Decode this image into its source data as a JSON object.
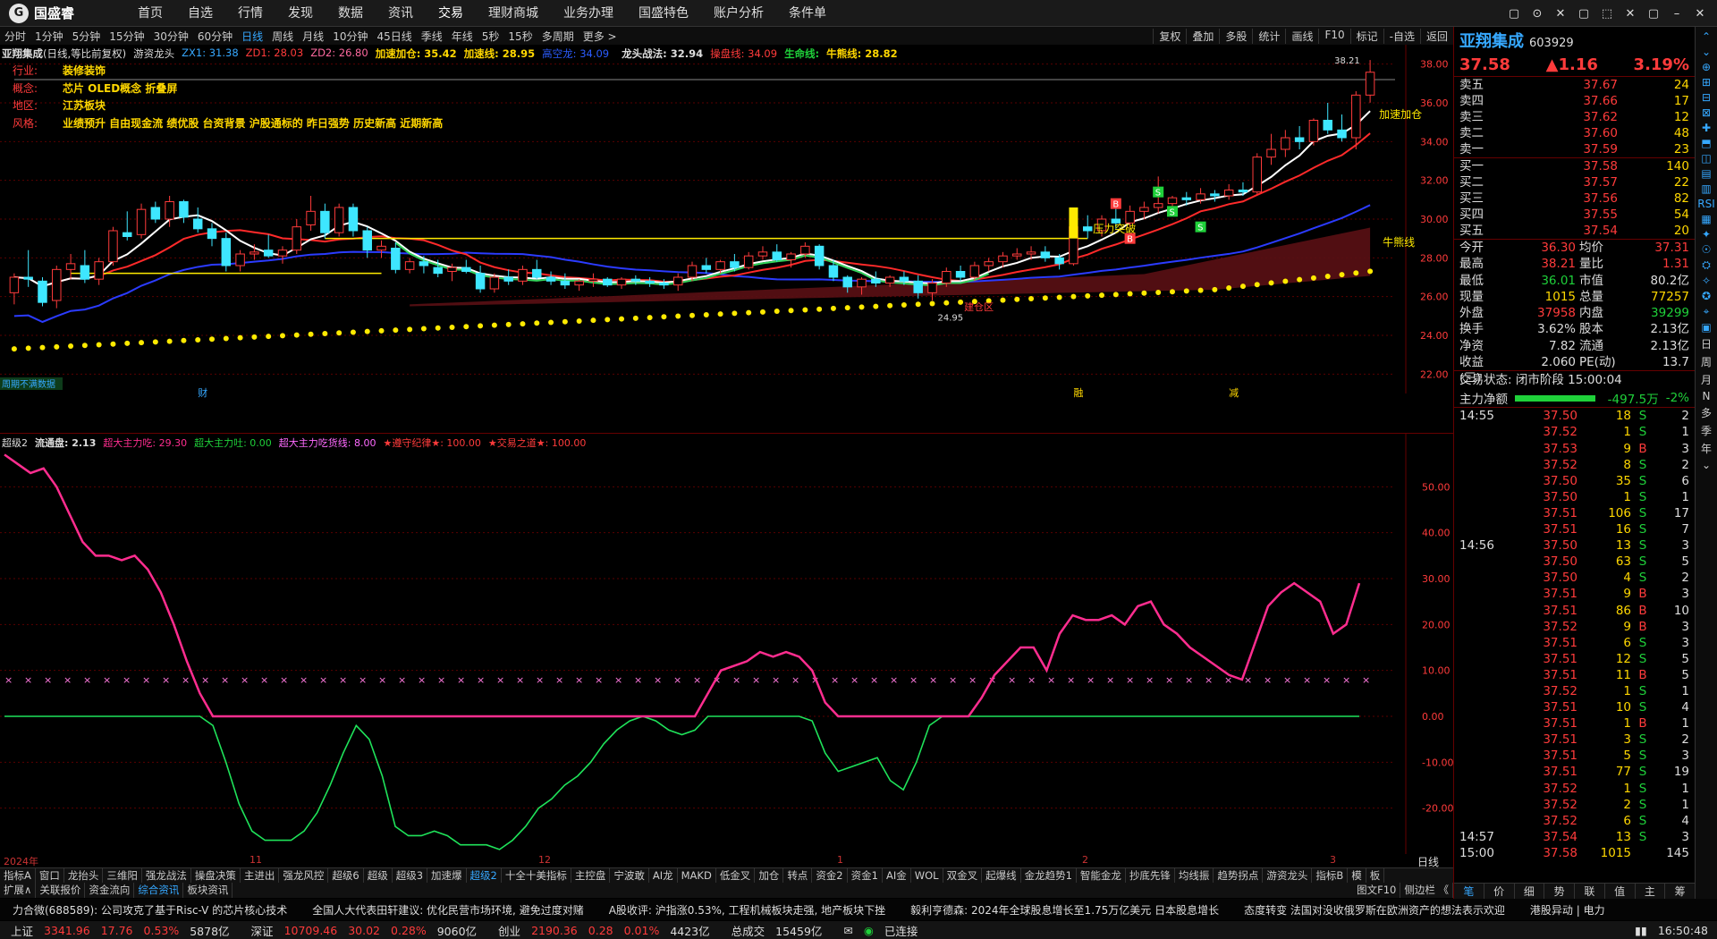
{
  "app": {
    "name": "国盛睿",
    "logo_glyph": "G"
  },
  "menu": [
    "首页",
    "自选",
    "行情",
    "发现",
    "数据",
    "资讯",
    "交易",
    "理财商城",
    "业务办理",
    "国盛特色",
    "账户分析",
    "条件单"
  ],
  "window_buttons": [
    "▢",
    "⊙",
    "✕",
    "▢",
    "⬚",
    "✕",
    "▢",
    "–",
    "✕"
  ],
  "periods": [
    "分时",
    "1分钟",
    "5分钟",
    "15分钟",
    "30分钟",
    "60分钟",
    "日线",
    "周线",
    "月线",
    "10分钟",
    "45日线",
    "季线",
    "年线",
    "5秒",
    "15秒",
    "多周期",
    "更多 >"
  ],
  "period_active": "日线",
  "toolbar_right": [
    "复权",
    "叠加",
    "多股",
    "统计",
    "画线",
    "F10",
    "标记",
    "-自选",
    "返回"
  ],
  "chart_header": {
    "stock": "亚翔集成",
    "mode": "(日线,等比前复权)",
    "formula": "游资龙头",
    "zx1": "ZX1: 31.38",
    "zd1": "ZD1: 28.03",
    "zd2": "ZD2: 26.80",
    "jsjc": "加速加仓: 35.42",
    "jsx": "加速线: 28.95",
    "gkl": "高空龙: 34.09",
    "lttf": "龙头战法: 32.94",
    "cpx": "操盘线: 34.09",
    "smx": "生命线:",
    "nsx": "牛熊线: 28.82"
  },
  "info": [
    {
      "k": "行业:",
      "v": "装修装饰"
    },
    {
      "k": "概念:",
      "v": "芯片 OLED概念 折叠屏"
    },
    {
      "k": "地区:",
      "v": "江苏板块"
    },
    {
      "k": "风格:",
      "v": "业绩预升 自由现金流 绩优股 台资背景 沪股通标的 昨日强势 历史新高 近期新高"
    }
  ],
  "annotations": {
    "high_label": "38.21",
    "low_label": "24.95",
    "jsjc_tag": "加速加仓",
    "nsx_tag": "牛熊线",
    "breakout": "压力突破",
    "zone": "建仓区",
    "fin_mark": "财",
    "rong_mark": "融",
    "jian_mark": "减",
    "left_note": "周期不满数据",
    "b_tag": "B",
    "s_tag": "S"
  },
  "price_axis": [
    "38.00",
    "36.00",
    "34.00",
    "32.00",
    "30.00",
    "28.00",
    "26.00",
    "24.00",
    "22.00"
  ],
  "indicator_header": {
    "name": "超级2",
    "ltp": "流通盘: 2.13",
    "czl": "超大主力吃: 29.30",
    "czt": "超大主力吐: 0.00",
    "czlh": "超大主力吃货线: 8.00",
    "zsjl": "★遵守纪律★: 100.00",
    "jyzd": "★交易之道★: 100.00"
  },
  "indicator_axis": [
    "50.00",
    "40.00",
    "30.00",
    "20.00",
    "10.00",
    "0.00",
    "-10.00",
    "-20.00"
  ],
  "date_axis": {
    "y2024": "2024年",
    "m11": "11",
    "m12": "12",
    "m1": "1",
    "m2": "2",
    "m3": "3",
    "label": "日线"
  },
  "tabs_row1": [
    "指标A",
    "窗口",
    "龙抬头",
    "三维阳",
    "强龙战法",
    "操盘决策",
    "主进出",
    "强龙风控",
    "超级6",
    "超级",
    "超级3",
    "加速爆",
    "超级2",
    "十全十美指标",
    "主控盘",
    "宁波敢",
    "AI龙",
    "MAKD",
    "低金叉",
    "加仓",
    "转点",
    "资金2",
    "资金1",
    "AI金",
    "WOL",
    "双金叉",
    "起爆线",
    "金龙趋势1",
    "智能金龙",
    "抄底先锋",
    "均线振",
    "趋势拐点",
    "游资龙头",
    "指标B",
    "模",
    "板"
  ],
  "tabs_row1_active": "超级2",
  "tabs_row2": [
    "扩展∧",
    "关联报价",
    "资金流向",
    "综合资讯",
    "板块资讯",
    "图文F10",
    "侧边栏 《"
  ],
  "ticker": [
    "力合微(688589): 公司攻克了基于Risc-V 的芯片核心技术",
    "全国人大代表田轩建议: 优化民营市场环境, 避免过度对赌",
    "A股收评: 沪指涨0.53%, 工程机械板块走强, 地产板块下挫",
    "毅利亨德森: 2024年全球股息增长至1.75万亿美元 日本股息增长",
    "态度转变 法国对没收俄罗斯在欧洲资产的想法表示欢迎",
    "港股异动 | 电力"
  ],
  "status": {
    "sh_label": "上证",
    "sh": "3341.96",
    "sh_chg": "17.76",
    "sh_pct": "0.53%",
    "sh_amt": "5878亿",
    "sz_label": "深证",
    "sz": "10709.46",
    "sz_chg": "30.02",
    "sz_pct": "0.28%",
    "sz_amt": "9060亿",
    "cy_label": "创业",
    "cy": "2190.36",
    "cy_chg": "0.28",
    "cy_pct": "0.01%",
    "cy_amt": "4423亿",
    "total_label": "总成交",
    "total": "15459亿",
    "conn": "已连接",
    "time": "16:50:48"
  },
  "quote": {
    "name": "亚翔集成",
    "code": "603929",
    "price": "37.58",
    "change": "▲1.16",
    "pct": "3.19%",
    "asks": [
      {
        "l": "卖五",
        "p": "37.67",
        "v": "24"
      },
      {
        "l": "卖四",
        "p": "37.66",
        "v": "17"
      },
      {
        "l": "卖三",
        "p": "37.62",
        "v": "12"
      },
      {
        "l": "卖二",
        "p": "37.60",
        "v": "48"
      },
      {
        "l": "卖一",
        "p": "37.59",
        "v": "23"
      }
    ],
    "bids": [
      {
        "l": "买一",
        "p": "37.58",
        "v": "140"
      },
      {
        "l": "买二",
        "p": "37.57",
        "v": "22"
      },
      {
        "l": "买三",
        "p": "37.56",
        "v": "82"
      },
      {
        "l": "买四",
        "p": "37.55",
        "v": "54"
      },
      {
        "l": "买五",
        "p": "37.54",
        "v": "20"
      }
    ],
    "stats": [
      {
        "k1": "今开",
        "v1": "36.30",
        "c1": "red",
        "k2": "均价",
        "v2": "37.31",
        "c2": "red"
      },
      {
        "k1": "最高",
        "v1": "38.21",
        "c1": "red",
        "k2": "量比",
        "v2": "1.31",
        "c2": "red"
      },
      {
        "k1": "最低",
        "v1": "36.01",
        "c1": "green",
        "k2": "市值",
        "v2": "80.2亿",
        "c2": "white"
      },
      {
        "k1": "现量",
        "v1": "1015",
        "c1": "yellow",
        "k2": "总量",
        "v2": "77257",
        "c2": "yellow"
      },
      {
        "k1": "外盘",
        "v1": "37958",
        "c1": "red",
        "k2": "内盘",
        "v2": "39299",
        "c2": "green"
      },
      {
        "k1": "换手",
        "v1": "3.62%",
        "c1": "white",
        "k2": "股本",
        "v2": "2.13亿",
        "c2": "white"
      },
      {
        "k1": "净资",
        "v1": "7.82",
        "c1": "white",
        "k2": "流通",
        "v2": "2.13亿",
        "c2": "white"
      },
      {
        "k1": "收益(三)",
        "v1": "2.060",
        "c1": "white",
        "k2": "PE(动)",
        "v2": "13.7",
        "c2": "white"
      }
    ],
    "trade_status": "交易状态: 闭市阶段 15:00:04",
    "flow_label": "主力净额",
    "flow_value": "-497.5万",
    "flow_pct": "-2%",
    "ticks": [
      {
        "t": "14:55",
        "p": "37.50",
        "v": "18",
        "bs": "S",
        "n": "2"
      },
      {
        "t": "",
        "p": "37.52",
        "v": "1",
        "bs": "S",
        "n": "1"
      },
      {
        "t": "",
        "p": "37.53",
        "v": "9",
        "bs": "B",
        "n": "3"
      },
      {
        "t": "",
        "p": "37.52",
        "v": "8",
        "bs": "S",
        "n": "2"
      },
      {
        "t": "",
        "p": "37.50",
        "v": "35",
        "bs": "S",
        "n": "6"
      },
      {
        "t": "",
        "p": "37.50",
        "v": "1",
        "bs": "S",
        "n": "1"
      },
      {
        "t": "",
        "p": "37.51",
        "v": "106",
        "bs": "S",
        "n": "17"
      },
      {
        "t": "",
        "p": "37.51",
        "v": "16",
        "bs": "S",
        "n": "7"
      },
      {
        "t": "14:56",
        "p": "37.50",
        "v": "13",
        "bs": "S",
        "n": "3"
      },
      {
        "t": "",
        "p": "37.50",
        "v": "63",
        "bs": "S",
        "n": "5"
      },
      {
        "t": "",
        "p": "37.50",
        "v": "4",
        "bs": "S",
        "n": "2"
      },
      {
        "t": "",
        "p": "37.51",
        "v": "9",
        "bs": "B",
        "n": "3"
      },
      {
        "t": "",
        "p": "37.51",
        "v": "86",
        "bs": "B",
        "n": "10"
      },
      {
        "t": "",
        "p": "37.52",
        "v": "9",
        "bs": "B",
        "n": "3"
      },
      {
        "t": "",
        "p": "37.51",
        "v": "6",
        "bs": "S",
        "n": "3"
      },
      {
        "t": "",
        "p": "37.51",
        "v": "12",
        "bs": "S",
        "n": "5"
      },
      {
        "t": "",
        "p": "37.51",
        "v": "11",
        "bs": "B",
        "n": "5"
      },
      {
        "t": "",
        "p": "37.52",
        "v": "1",
        "bs": "S",
        "n": "1"
      },
      {
        "t": "",
        "p": "37.51",
        "v": "10",
        "bs": "S",
        "n": "4"
      },
      {
        "t": "",
        "p": "37.51",
        "v": "1",
        "bs": "B",
        "n": "1"
      },
      {
        "t": "",
        "p": "37.51",
        "v": "3",
        "bs": "S",
        "n": "2"
      },
      {
        "t": "",
        "p": "37.51",
        "v": "5",
        "bs": "S",
        "n": "3"
      },
      {
        "t": "",
        "p": "37.51",
        "v": "77",
        "bs": "S",
        "n": "19"
      },
      {
        "t": "",
        "p": "37.52",
        "v": "1",
        "bs": "S",
        "n": "1"
      },
      {
        "t": "",
        "p": "37.52",
        "v": "2",
        "bs": "S",
        "n": "1"
      },
      {
        "t": "",
        "p": "37.52",
        "v": "6",
        "bs": "S",
        "n": "4"
      },
      {
        "t": "14:57",
        "p": "37.54",
        "v": "13",
        "bs": "S",
        "n": "3"
      },
      {
        "t": "15:00",
        "p": "37.58",
        "v": "1015",
        "bs": "",
        "n": "145"
      }
    ],
    "qtabs": [
      "笔",
      "价",
      "细",
      "势",
      "联",
      "值",
      "主",
      "筹"
    ]
  },
  "sidebar": [
    "⌃",
    "⌄",
    "⊕",
    "⊞",
    "⊟",
    "⊠",
    "✚",
    "⬒",
    "◫",
    "▤",
    "▥",
    "RSI",
    "▦",
    "✦",
    "☉",
    "⛭",
    "✧",
    "✪",
    "⌖",
    "▣",
    "日",
    "周",
    "月",
    "N",
    "多",
    "季",
    "年",
    "⌄"
  ],
  "colors": {
    "up": "#ff3b3b",
    "down": "#1fd13a",
    "accent": "#36a8ff",
    "ma_white": "#ffffff",
    "ma_red": "#ff2a2a",
    "ma_blue": "#2b3bff",
    "ma_green": "#32d35a",
    "dotted": "#ffea00",
    "ribbon": "#5a0f14"
  },
  "chart_data": {
    "type": "line",
    "title": "亚翔集成",
    "price_range": [
      21.0,
      39.0
    ],
    "indicator_range": [
      -30,
      60
    ],
    "candles_ohlc": [
      [
        26.2,
        27.2,
        25.6,
        27.0
      ],
      [
        27.0,
        28.4,
        26.5,
        26.9
      ],
      [
        26.8,
        27.0,
        25.5,
        25.7
      ],
      [
        25.8,
        27.6,
        25.4,
        27.4
      ],
      [
        27.4,
        28.2,
        26.9,
        27.7
      ],
      [
        27.6,
        28.4,
        26.7,
        26.9
      ],
      [
        26.9,
        28.0,
        26.6,
        27.8
      ],
      [
        27.8,
        29.6,
        27.6,
        29.4
      ],
      [
        29.3,
        30.4,
        28.9,
        29.1
      ],
      [
        29.2,
        30.8,
        29.0,
        30.5
      ],
      [
        30.6,
        30.9,
        29.8,
        30.0
      ],
      [
        30.0,
        31.2,
        29.6,
        30.9
      ],
      [
        30.9,
        31.0,
        29.8,
        30.1
      ],
      [
        30.0,
        30.6,
        29.3,
        29.5
      ],
      [
        29.5,
        29.8,
        28.6,
        29.0
      ],
      [
        29.0,
        29.3,
        27.3,
        27.6
      ],
      [
        27.6,
        28.4,
        27.3,
        28.2
      ],
      [
        28.2,
        28.7,
        27.9,
        28.3
      ],
      [
        28.4,
        29.2,
        28.0,
        28.1
      ],
      [
        28.1,
        28.6,
        27.7,
        28.4
      ],
      [
        28.4,
        30.0,
        28.2,
        29.6
      ],
      [
        29.7,
        31.2,
        29.4,
        30.4
      ],
      [
        30.4,
        30.8,
        29.0,
        29.3
      ],
      [
        29.3,
        30.8,
        29.1,
        30.6
      ],
      [
        30.6,
        30.8,
        29.1,
        29.4
      ],
      [
        29.4,
        29.6,
        28.0,
        28.4
      ],
      [
        28.4,
        28.9,
        28.0,
        28.6
      ],
      [
        28.5,
        28.8,
        27.2,
        27.4
      ],
      [
        27.4,
        28.0,
        27.2,
        27.8
      ],
      [
        27.8,
        28.1,
        27.2,
        27.6
      ],
      [
        27.5,
        27.9,
        27.0,
        27.2
      ],
      [
        27.3,
        27.7,
        26.8,
        27.5
      ],
      [
        27.5,
        27.9,
        27.2,
        27.3
      ],
      [
        27.2,
        27.6,
        26.2,
        26.4
      ],
      [
        26.4,
        27.2,
        26.2,
        27.0
      ],
      [
        27.0,
        27.4,
        26.6,
        26.8
      ],
      [
        26.8,
        27.6,
        26.6,
        27.4
      ],
      [
        27.4,
        27.9,
        26.9,
        27.0
      ],
      [
        27.0,
        27.3,
        26.6,
        26.8
      ],
      [
        26.8,
        27.2,
        26.4,
        26.6
      ],
      [
        26.6,
        26.9,
        26.3,
        26.8
      ],
      [
        26.8,
        27.2,
        26.5,
        26.9
      ],
      [
        26.9,
        27.0,
        26.5,
        26.6
      ],
      [
        26.6,
        27.0,
        26.4,
        26.9
      ],
      [
        26.9,
        27.1,
        26.6,
        26.8
      ],
      [
        26.8,
        27.0,
        26.5,
        26.7
      ],
      [
        26.7,
        26.9,
        26.4,
        26.6
      ],
      [
        26.6,
        27.2,
        26.3,
        27.0
      ],
      [
        27.0,
        27.8,
        26.8,
        27.6
      ],
      [
        27.6,
        28.0,
        27.2,
        27.4
      ],
      [
        27.4,
        27.9,
        27.2,
        27.8
      ],
      [
        27.8,
        28.2,
        27.3,
        27.5
      ],
      [
        27.5,
        28.3,
        27.4,
        28.1
      ],
      [
        28.1,
        28.6,
        27.9,
        28.3
      ],
      [
        28.3,
        28.7,
        27.8,
        27.9
      ],
      [
        27.9,
        28.3,
        27.5,
        28.2
      ],
      [
        28.2,
        28.8,
        28.0,
        28.6
      ],
      [
        28.6,
        28.7,
        27.4,
        27.6
      ],
      [
        27.6,
        27.9,
        26.8,
        27.0
      ],
      [
        27.0,
        27.1,
        26.2,
        26.5
      ],
      [
        26.5,
        27.0,
        26.1,
        26.9
      ],
      [
        26.9,
        27.3,
        26.5,
        26.7
      ],
      [
        26.7,
        27.1,
        26.5,
        27.0
      ],
      [
        27.0,
        27.3,
        26.6,
        26.8
      ],
      [
        26.8,
        27.1,
        25.9,
        26.2
      ],
      [
        26.2,
        26.9,
        25.8,
        26.7
      ],
      [
        26.7,
        27.5,
        26.5,
        27.3
      ],
      [
        27.3,
        27.6,
        26.8,
        27.0
      ],
      [
        27.0,
        27.8,
        26.8,
        27.6
      ],
      [
        27.6,
        28.0,
        27.3,
        27.8
      ],
      [
        27.8,
        28.3,
        27.5,
        28.1
      ],
      [
        28.1,
        28.5,
        27.9,
        28.2
      ],
      [
        28.2,
        28.6,
        27.9,
        28.3
      ],
      [
        28.3,
        28.6,
        27.8,
        28.0
      ],
      [
        28.0,
        28.2,
        27.4,
        27.7
      ],
      [
        27.7,
        29.8,
        27.6,
        29.6
      ],
      [
        29.6,
        30.2,
        29.0,
        29.4
      ],
      [
        29.4,
        30.2,
        29.1,
        30.0
      ],
      [
        30.0,
        30.6,
        29.5,
        29.8
      ],
      [
        29.8,
        30.7,
        29.6,
        30.4
      ],
      [
        30.4,
        30.9,
        30.0,
        30.6
      ],
      [
        30.6,
        32.2,
        30.3,
        30.8
      ],
      [
        30.8,
        31.2,
        30.4,
        31.1
      ],
      [
        31.1,
        31.4,
        30.7,
        31.0
      ],
      [
        31.0,
        31.6,
        30.8,
        31.3
      ],
      [
        31.3,
        31.5,
        30.9,
        31.2
      ],
      [
        31.2,
        31.8,
        31.0,
        31.5
      ],
      [
        31.5,
        31.9,
        31.2,
        31.4
      ],
      [
        31.4,
        33.4,
        31.3,
        33.2
      ],
      [
        33.2,
        34.4,
        32.8,
        33.6
      ],
      [
        33.6,
        34.6,
        33.2,
        34.2
      ],
      [
        34.2,
        34.8,
        33.6,
        34.0
      ],
      [
        34.0,
        35.2,
        33.8,
        35.1
      ],
      [
        35.1,
        36.0,
        34.4,
        34.6
      ],
      [
        34.6,
        35.4,
        34.0,
        34.2
      ],
      [
        34.2,
        36.6,
        33.6,
        36.4
      ],
      [
        36.4,
        38.21,
        36.01,
        37.58
      ]
    ],
    "indicator_pink": [
      57,
      55,
      53,
      54,
      50,
      44,
      38,
      35,
      35,
      34,
      35,
      32,
      27,
      20,
      12,
      5,
      0,
      0,
      0,
      0,
      0,
      0,
      0,
      0,
      0,
      0,
      0,
      0,
      0,
      0,
      0,
      0,
      0,
      0,
      0,
      0,
      0,
      0,
      0,
      0,
      0,
      0,
      0,
      0,
      0,
      0,
      0,
      0,
      0,
      0,
      0,
      0,
      0,
      0,
      5,
      10,
      11,
      12,
      14,
      13,
      14,
      13,
      10,
      3,
      0,
      0,
      0,
      0,
      0,
      0,
      0,
      0,
      0,
      0,
      0,
      4,
      9,
      12,
      15,
      15,
      10,
      18,
      22,
      21,
      21,
      22,
      20,
      24,
      25,
      20,
      18,
      15,
      13,
      11,
      9,
      8,
      16,
      24,
      27,
      29,
      27,
      25,
      18,
      20,
      29
    ],
    "indicator_green": [
      0,
      0,
      0,
      0,
      0,
      0,
      0,
      0,
      0,
      0,
      0,
      0,
      0,
      0,
      0,
      0,
      -2,
      -10,
      -19,
      -25,
      -27,
      -27,
      -27,
      -25,
      -21,
      -15,
      -8,
      -2,
      -5,
      -13,
      -24,
      -26,
      -26,
      -25,
      -26,
      -28,
      -28,
      -28,
      -29,
      -27,
      -24,
      -20,
      -18,
      -15,
      -13,
      -10,
      -6,
      -3,
      -1,
      0,
      -1,
      -3,
      -4,
      -3,
      0,
      0,
      0,
      0,
      0,
      0,
      0,
      0,
      -1,
      -8,
      -12,
      -11,
      -10,
      -9,
      -14,
      -16,
      -10,
      -2,
      0,
      0,
      0,
      0,
      0,
      0,
      0,
      0,
      0,
      0,
      0,
      0,
      0,
      0,
      0,
      0,
      0,
      0,
      0,
      0,
      0,
      0,
      0,
      0,
      0,
      0,
      0,
      0,
      0,
      0,
      0,
      0,
      0
    ],
    "indicator_ref_line": 8.0,
    "series": [
      {
        "name": "牛熊线",
        "values": []
      },
      {
        "name": "加速线",
        "values": []
      }
    ]
  }
}
